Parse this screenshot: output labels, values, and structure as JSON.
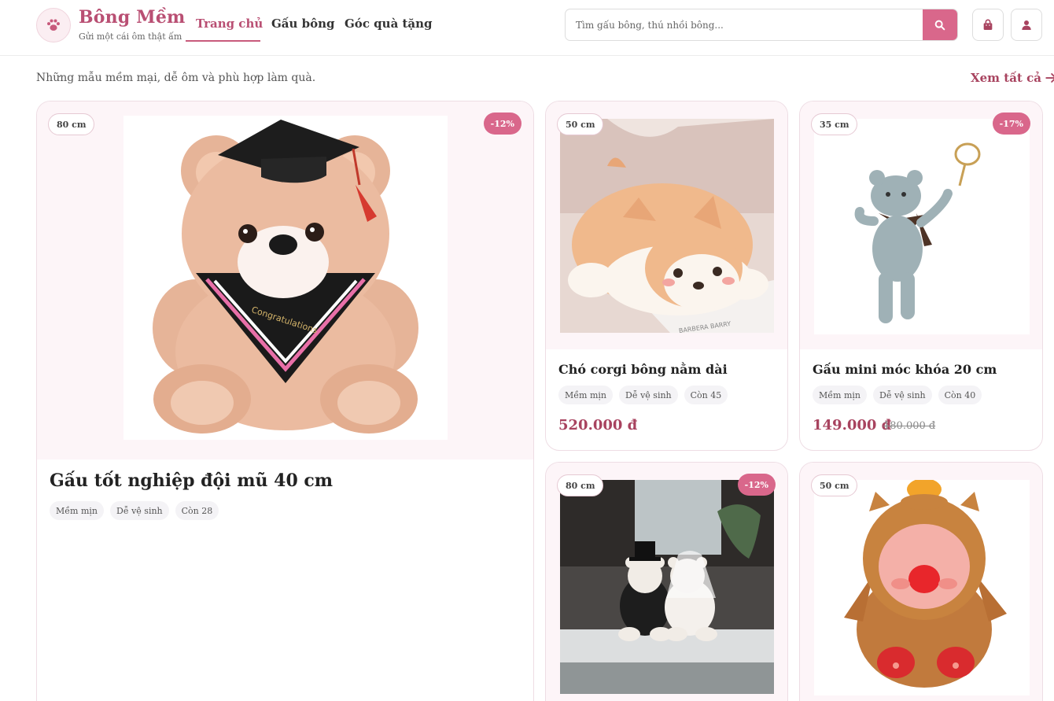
{
  "brand": {
    "name": "Bông Mềm",
    "tagline": "Gửi một cái ôm thật ấm"
  },
  "nav": {
    "home": "Trang chủ",
    "bears": "Gấu bông",
    "gifts": "Góc quà tặng"
  },
  "search": {
    "placeholder": "Tìm gấu bông, thú nhồi bông..."
  },
  "icons": {
    "logo": "paw-icon",
    "search": "search-icon",
    "bag": "shopping-bag-icon",
    "user": "user-icon",
    "arrow": "arrow-right-icon"
  },
  "colors": {
    "accent": "#d9678b",
    "brand": "#b94f73",
    "price": "#a8435f",
    "image_bg": "#fdf5f8"
  },
  "section": {
    "title": "",
    "subtitle": "Những mẫu mềm mại, dễ ôm và phù hợp làm quà.",
    "see_all": "Xem tất cả"
  },
  "products": [
    {
      "size": "80 cm",
      "discount": "-12%",
      "name": "Gấu tốt nghiệp đội mũ 40 cm",
      "tags": [
        "Mềm mịn",
        "Dễ vệ sinh",
        "Còn 28"
      ]
    },
    {
      "size": "50 cm",
      "name": "Chó corgi bông nằm dài",
      "tags": [
        "Mềm mịn",
        "Dễ vệ sinh",
        "Còn 45"
      ],
      "price": "520.000 đ"
    },
    {
      "size": "35 cm",
      "discount": "-17%",
      "name": "Gấu mini móc khóa 20 cm",
      "tags": [
        "Mềm mịn",
        "Dễ vệ sinh",
        "Còn 40"
      ],
      "price": "149.000 đ",
      "old_price": "180.000 đ"
    },
    {
      "size": "80 cm",
      "discount": "-12%"
    },
    {
      "size": "50 cm"
    }
  ]
}
